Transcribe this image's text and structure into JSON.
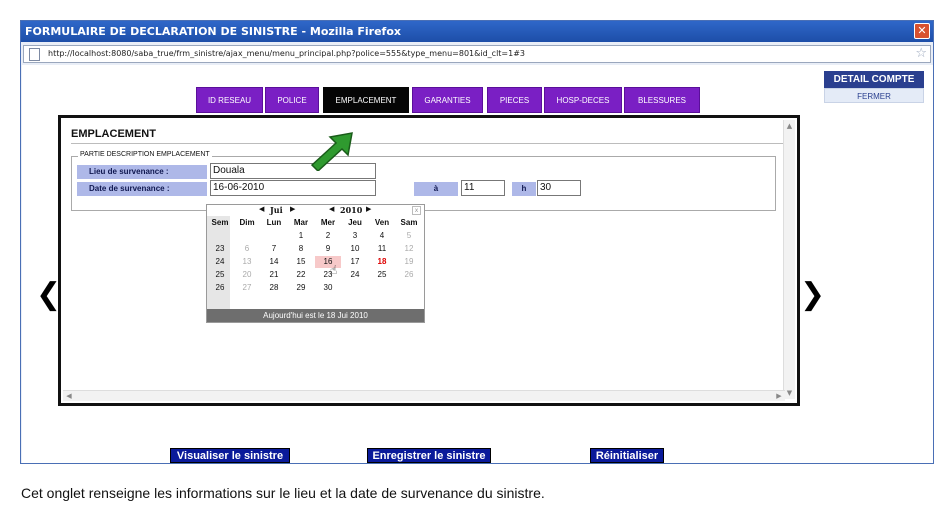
{
  "window": {
    "title": "FORMULAIRE DE DECLARATION DE SINISTRE - Mozilla Firefox",
    "close_icon": "✕",
    "url": "http://localhost:8080/saba_true/frm_sinistre/ajax_menu/menu_principal.php?police=555&type_menu=801&id_clt=1#3",
    "star_icon": "☆"
  },
  "right_panel": {
    "detail_compte": "DETAIL COMPTE",
    "fermer": "FERMER"
  },
  "tabs": [
    {
      "label": "ID RESEAU",
      "active": false
    },
    {
      "label": "POLICE",
      "active": false
    },
    {
      "label": "EMPLACEMENT",
      "active": true
    },
    {
      "label": "GARANTIES",
      "active": false
    },
    {
      "label": "PIECES",
      "active": false
    },
    {
      "label": "HOSP-DECES",
      "active": false
    },
    {
      "label": "BLESSURES",
      "active": false
    }
  ],
  "nav_arrows": {
    "left": "❮",
    "right": "❯"
  },
  "section": {
    "title": "EMPLACEMENT",
    "legend": "PARTIE DESCRIPTION EMPLACEMENT"
  },
  "fields": {
    "lieu_label": "Lieu de survenance :",
    "lieu_value": "Douala",
    "date_label": "Date de survenance :",
    "date_value": "16-06-2010",
    "a_label": "à",
    "hour_value": "11",
    "h_label": "h",
    "minute_value": "30"
  },
  "calendar": {
    "month": "Jui",
    "year": "2010",
    "nav_prev": "◀",
    "nav_next": "▶",
    "close": "x",
    "headers": [
      "Sem",
      "Dim",
      "Lun",
      "Mar",
      "Mer",
      "Jeu",
      "Ven",
      "Sam"
    ],
    "weeks": [
      [
        "",
        "",
        "",
        "1",
        "2",
        "3",
        "4",
        "5"
      ],
      [
        "23",
        "6",
        "7",
        "8",
        "9",
        "10",
        "11",
        "12"
      ],
      [
        "24",
        "13",
        "14",
        "15",
        "16",
        "17",
        "18",
        "19"
      ],
      [
        "25",
        "20",
        "21",
        "22",
        "23",
        "24",
        "25",
        "26"
      ],
      [
        "26",
        "27",
        "28",
        "29",
        "30",
        "",
        "",
        ""
      ]
    ],
    "today_day": "18",
    "selected_day": "16",
    "footer": "Aujourd'hui est le 18 Jui 2010"
  },
  "buttons": {
    "visualiser": "Visualiser le sinistre",
    "enregistrer": "Enregistrer le sinistre",
    "reinitialiser": "Réinitialiser"
  },
  "caption": "Cet onglet renseigne les informations sur le lieu et la date de survenance du sinistre.",
  "colors": {
    "tab": "#7a1fc4",
    "tab_active": "#050505",
    "button": "#0a1a9a",
    "label_bg": "#aeb8e8",
    "annotation_arrow": "#2f9a2f"
  }
}
